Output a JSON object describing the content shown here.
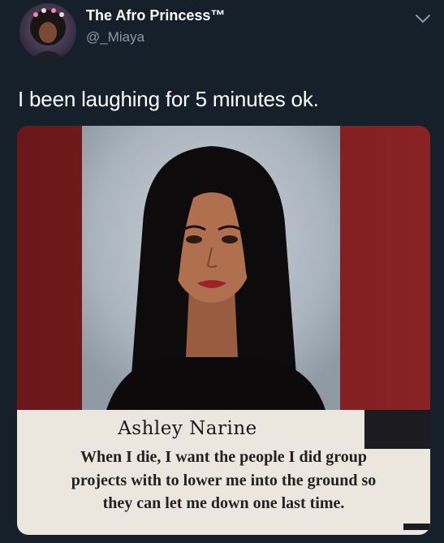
{
  "tweet": {
    "author": {
      "display_name": "The Afro Princess™",
      "handle": "@_Miaya",
      "avatar_icon": "avatar-photo"
    },
    "menu_icon": "chevron-down-icon",
    "text": "I been laughing for 5 minutes ok."
  },
  "media": {
    "caption_name": "Ashley Narine",
    "quote_lines": [
      "When I die, I want the people I did group",
      "projects with to lower me into the ground so",
      "they can let me down one last time."
    ]
  },
  "colors": {
    "background": "#15202b",
    "secondary_text": "#8899a6",
    "frame_red": "#7e1d1f",
    "caption_paper": "#ebe7df"
  }
}
